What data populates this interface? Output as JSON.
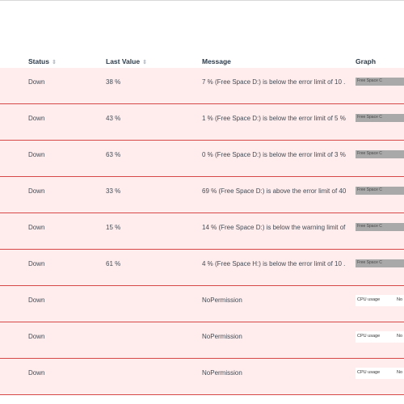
{
  "header": {
    "columns": {
      "status": "Status",
      "last_value": "Last Value",
      "message": "Message",
      "graph": "Graph"
    },
    "sort_icon": "sort-arrows-icon"
  },
  "rows": [
    {
      "status": "Down",
      "last_value": "38 %",
      "message": "7 % (Free Space D:) is below the error limit of 10 ...",
      "graph_type": "bar",
      "graph_label": "Free Space C"
    },
    {
      "status": "Down",
      "last_value": "43 %",
      "message": "1 % (Free Space D:) is below the error limit of 5 % ...",
      "graph_type": "bar",
      "graph_label": "Free Space C"
    },
    {
      "status": "Down",
      "last_value": "63 %",
      "message": "0 % (Free Space D:) is below the error limit of 3 % ...",
      "graph_type": "bar",
      "graph_label": "Free Space C"
    },
    {
      "status": "Down",
      "last_value": "33 %",
      "message": "69 % (Free Space D:) is above the error limit of 40...",
      "graph_type": "bar",
      "graph_label": "Free Space C"
    },
    {
      "status": "Down",
      "last_value": "15 %",
      "message": "14 % (Free Space D:) is below the warning limit of...",
      "graph_type": "bar",
      "graph_label": "Free Space C"
    },
    {
      "status": "Down",
      "last_value": "61 %",
      "message": "4 % (Free Space H:) is below the error limit of 10 ...",
      "graph_type": "bar",
      "graph_label": "Free Space C"
    },
    {
      "status": "Down",
      "last_value": "",
      "message": "NoPermission",
      "graph_type": "cpu",
      "graph_label": "CPU usage",
      "graph_value": "No"
    },
    {
      "status": "Down",
      "last_value": "",
      "message": "NoPermission",
      "graph_type": "cpu",
      "graph_label": "CPU usage",
      "graph_value": "No"
    },
    {
      "status": "Down",
      "last_value": "",
      "message": "NoPermission",
      "graph_type": "cpu",
      "graph_label": "CPU usage",
      "graph_value": "No"
    }
  ],
  "colors": {
    "row_error_bg": "#ffecec",
    "row_error_border": "#d64747",
    "header_accent": "#1e88e5"
  }
}
